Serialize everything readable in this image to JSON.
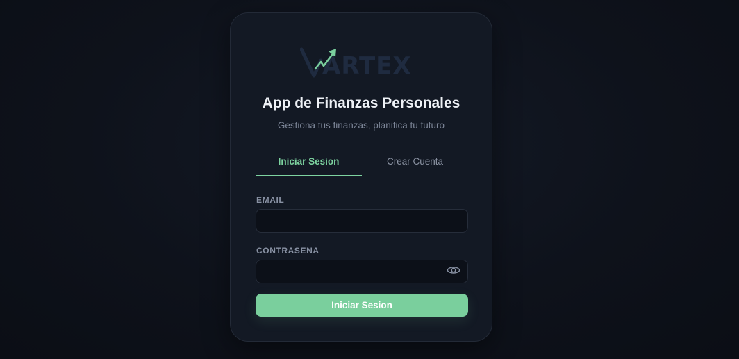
{
  "brand": {
    "logo_text": "ARTEX",
    "logo_icon": "v-arrow-up-icon",
    "accent_color": "#7acf9d",
    "logo_text_color": "#1f2b40"
  },
  "header": {
    "title": "App de Finanzas Personales",
    "subtitle": "Gestiona tus finanzas, planifica tu futuro"
  },
  "tabs": [
    {
      "label": "Iniciar Sesion",
      "active": true
    },
    {
      "label": "Crear Cuenta",
      "active": false
    }
  ],
  "form": {
    "email": {
      "label": "EMAIL",
      "value": "",
      "placeholder": ""
    },
    "password": {
      "label": "CONTRASENA",
      "value": "",
      "placeholder": "",
      "toggle_icon": "eye-icon"
    },
    "submit_label": "Iniciar Sesion"
  }
}
